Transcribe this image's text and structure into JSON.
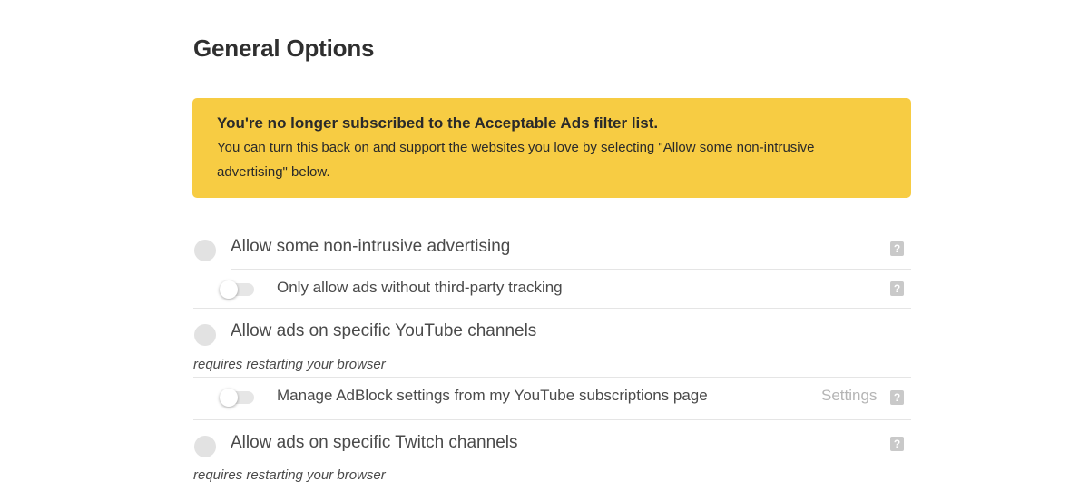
{
  "page": {
    "title": "General Options"
  },
  "notice": {
    "heading": "You're no longer subscribed to the Acceptable Ads filter list.",
    "body": "You can turn this back on and support the websites you love by selecting \"Allow some non-intrusive advertising\" below.",
    "background_color": "#f7cc43"
  },
  "options": {
    "acceptable_ads": {
      "label": "Allow some non-intrusive advertising",
      "selected": false,
      "help_icon": "question-mark-icon",
      "sub_option": {
        "label": "Only allow ads without third-party tracking",
        "enabled": false,
        "help_icon": "question-mark-icon"
      }
    },
    "youtube": {
      "label": "Allow ads on specific YouTube channels",
      "selected": false,
      "note": "requires restarting your browser",
      "sub_option": {
        "label": "Manage AdBlock settings from my YouTube subscriptions page",
        "enabled": false,
        "settings_label": "Settings",
        "help_icon": "question-mark-icon"
      }
    },
    "twitch": {
      "label": "Allow ads on specific Twitch channels",
      "selected": false,
      "note": "requires restarting your browser",
      "help_icon": "question-mark-icon"
    }
  },
  "help_glyph": "?"
}
